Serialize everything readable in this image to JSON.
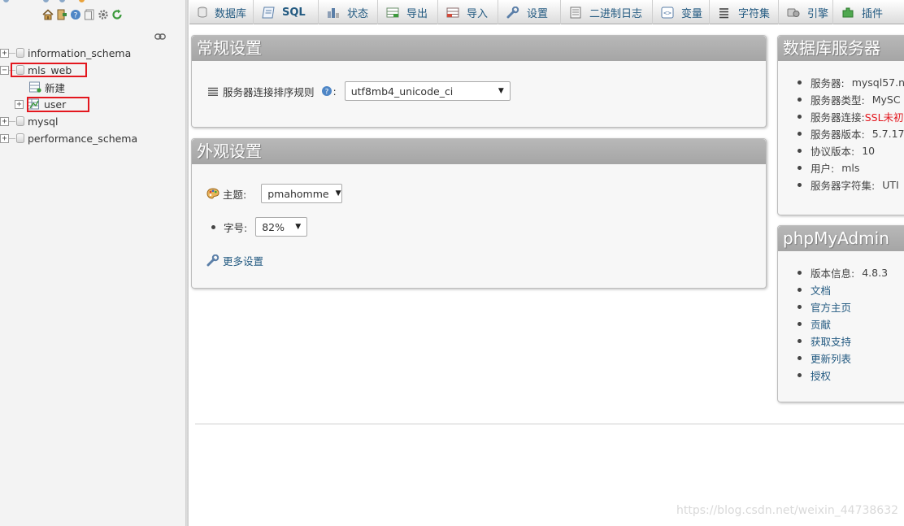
{
  "nav": {
    "databases": [
      {
        "name": "information_schema",
        "expanded": false
      },
      {
        "name": "mls_web",
        "expanded": true,
        "children": [
          "新建",
          "user"
        ]
      },
      {
        "name": "mysql",
        "expanded": false
      },
      {
        "name": "performance_schema",
        "expanded": false
      }
    ],
    "toolbar_icons": [
      "home-icon",
      "logout-icon",
      "help-icon",
      "docs-icon",
      "settings-icon",
      "reload-icon"
    ],
    "highlight_color": "#e3171e"
  },
  "tabs": [
    {
      "label": "数据库",
      "icon": "database-icon"
    },
    {
      "label": "SQL",
      "icon": "sql-icon"
    },
    {
      "label": "状态",
      "icon": "status-icon"
    },
    {
      "label": "导出",
      "icon": "export-icon"
    },
    {
      "label": "导入",
      "icon": "import-icon"
    },
    {
      "label": "设置",
      "icon": "settings-wrench-icon"
    },
    {
      "label": "二进制日志",
      "icon": "binlog-icon"
    },
    {
      "label": "变量",
      "icon": "variables-icon"
    },
    {
      "label": "字符集",
      "icon": "charset-icon"
    },
    {
      "label": "引擎",
      "icon": "engine-icon"
    },
    {
      "label": "插件",
      "icon": "plugin-icon"
    }
  ],
  "general": {
    "title": "常规设置",
    "collation_label": "服务器连接排序规则",
    "collation_value": "utf8mb4_unicode_ci"
  },
  "appearance": {
    "title": "外观设置",
    "theme_label": "主题:",
    "theme_value": "pmahomme",
    "font_label": "字号:",
    "font_value": "82%",
    "more_settings": "更多设置"
  },
  "db_server": {
    "title": "数据库服务器",
    "items": [
      {
        "label": "服务器:",
        "value": "mysql57.n"
      },
      {
        "label": "服务器类型:",
        "value": "MySC"
      },
      {
        "label": "服务器连接:",
        "value": "SSL未初",
        "warn": true
      },
      {
        "label": "服务器版本:",
        "value": "5.7.17"
      },
      {
        "label": "协议版本:",
        "value": "10"
      },
      {
        "label": "用户:",
        "value": "mls"
      },
      {
        "label": "服务器字符集:",
        "value": "UTI"
      }
    ]
  },
  "pma": {
    "title": "phpMyAdmin",
    "version_label": "版本信息:",
    "version_value": "4.8.3",
    "links": [
      "文档",
      "官方主页",
      "贡献",
      "获取支持",
      "更新列表",
      "授权"
    ]
  },
  "watermark": "https://blog.csdn.net/weixin_44738632"
}
